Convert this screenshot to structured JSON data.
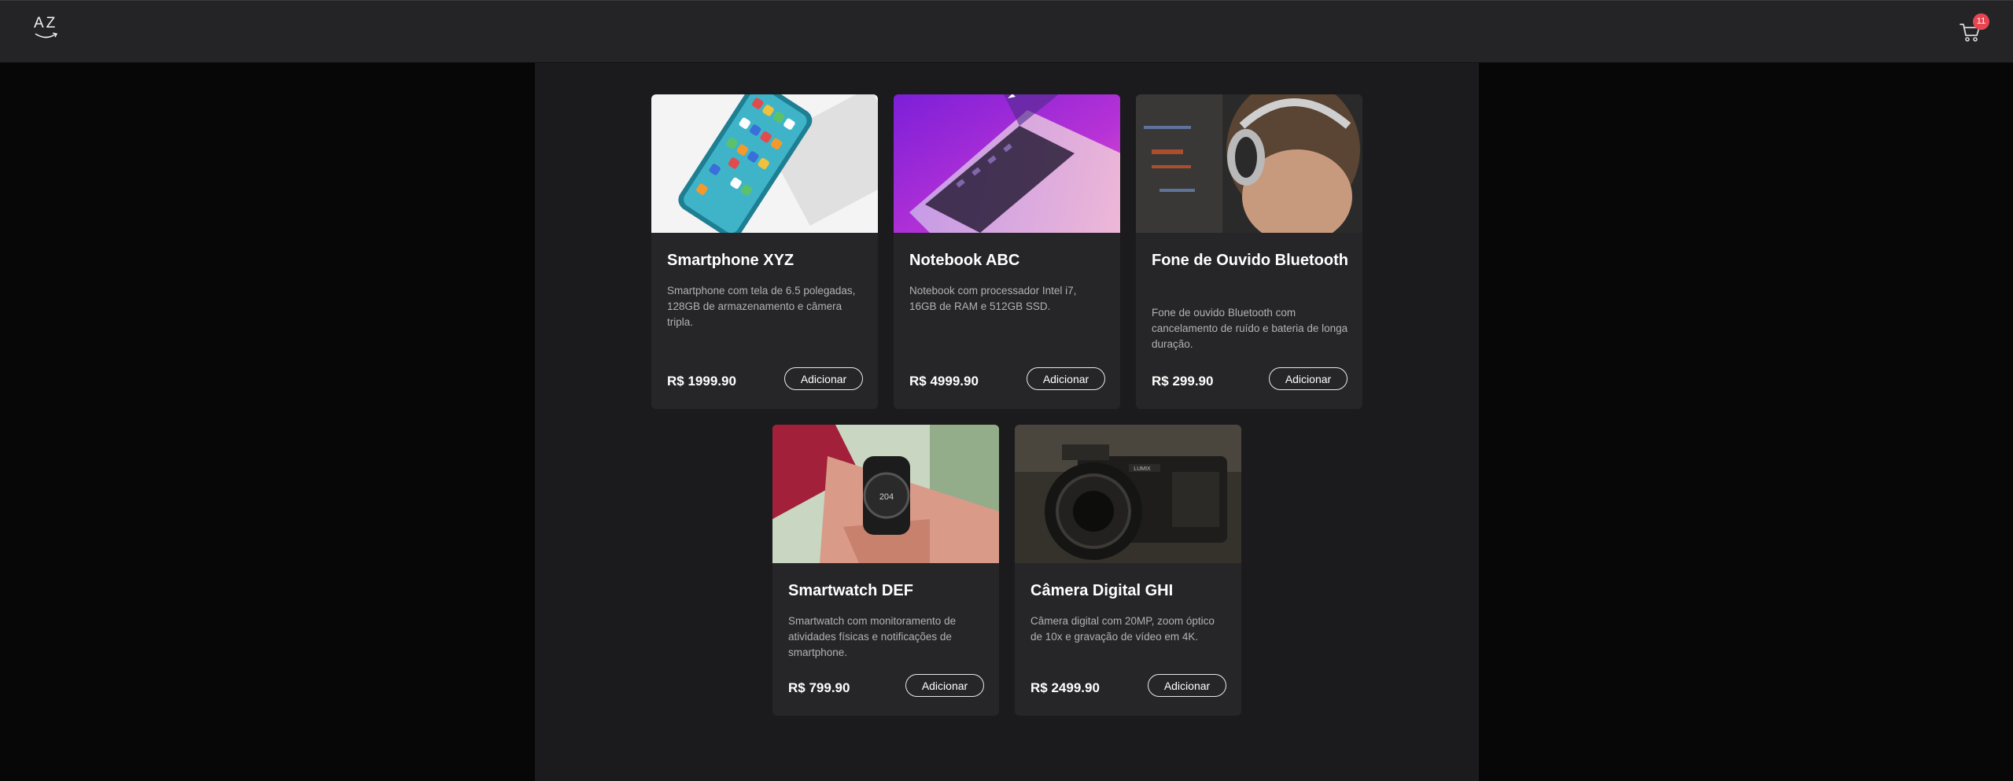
{
  "header": {
    "logo_text": "AZ",
    "cart_icon": "shopping-cart-icon",
    "cart_count": "11",
    "badge_color": "#e74552"
  },
  "products": [
    {
      "name": "Smartphone XYZ",
      "description": "Smartphone com tela de 6.5 polegadas, 128GB de armazenamento e câmera tripla.",
      "price": "R$ 1999.90",
      "button_label": "Adicionar",
      "image": "smartphone-photo"
    },
    {
      "name": "Notebook ABC",
      "description": "Notebook com processador Intel i7, 16GB de RAM e 512GB SSD.",
      "price": "R$ 4999.90",
      "button_label": "Adicionar",
      "image": "notebook-photo"
    },
    {
      "name": "Fone de Ouvido Bluetooth",
      "description": "Fone de ouvido Bluetooth com cancelamento de ruído e bateria de longa duração.",
      "price": "R$ 299.90",
      "button_label": "Adicionar",
      "image": "headphones-photo"
    },
    {
      "name": "Smartwatch DEF",
      "description": "Smartwatch com monitoramento de atividades físicas e notificações de smartphone.",
      "price": "R$ 799.90",
      "button_label": "Adicionar",
      "image": "smartwatch-photo"
    },
    {
      "name": "Câmera Digital GHI",
      "description": "Câmera digital com 20MP, zoom óptico de 10x e gravação de vídeo em 4K.",
      "price": "R$ 2499.90",
      "button_label": "Adicionar",
      "image": "camera-photo"
    }
  ],
  "colors": {
    "page_bg": "#070707",
    "navbar_bg": "#242426",
    "main_bg": "#1b1b1d",
    "card_bg": "#262628"
  }
}
